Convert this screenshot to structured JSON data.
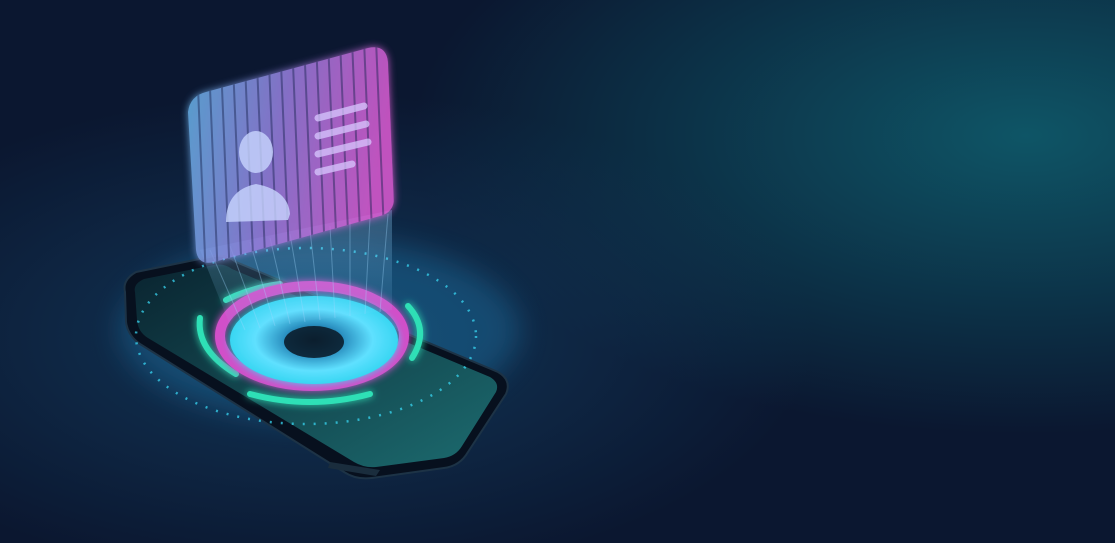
{
  "scene": {
    "subject": "holographic-id-card-over-smartphone",
    "icons": [
      "id-card-icon",
      "person-silhouette-icon",
      "smartphone-icon"
    ],
    "colors": {
      "background_dark": "#0b1730",
      "background_mid": "#123a5c",
      "background_teal": "#0e5566",
      "hologram_pink": "#e05cd6",
      "hologram_violet": "#9a7fe0",
      "hologram_blue": "#63b8ea",
      "ring_cyan": "#38d6f2",
      "ring_teal": "#2fe0b6",
      "ring_magenta": "#d14fc9",
      "phone_body": "#07101e",
      "phone_screen": "#0f3a4a"
    }
  }
}
